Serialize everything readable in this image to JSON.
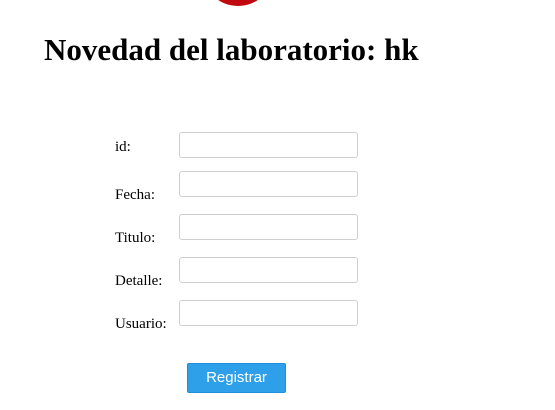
{
  "page": {
    "title": "Novedad del laboratorio: hk"
  },
  "form": {
    "fields": [
      {
        "label": "id:",
        "value": "",
        "placeholder": ""
      },
      {
        "label": "Fecha:",
        "value": "",
        "placeholder": ""
      },
      {
        "label": "Titulo:",
        "value": "",
        "placeholder": ""
      },
      {
        "label": "Detalle:",
        "value": "",
        "placeholder": ""
      },
      {
        "label": "Usuario:",
        "value": "",
        "placeholder": ""
      }
    ],
    "submit_label": "Registrar"
  },
  "colors": {
    "logo_red": "#c0090f",
    "button_blue": "#2ea0ea",
    "field_border": "#cfcfcf"
  }
}
